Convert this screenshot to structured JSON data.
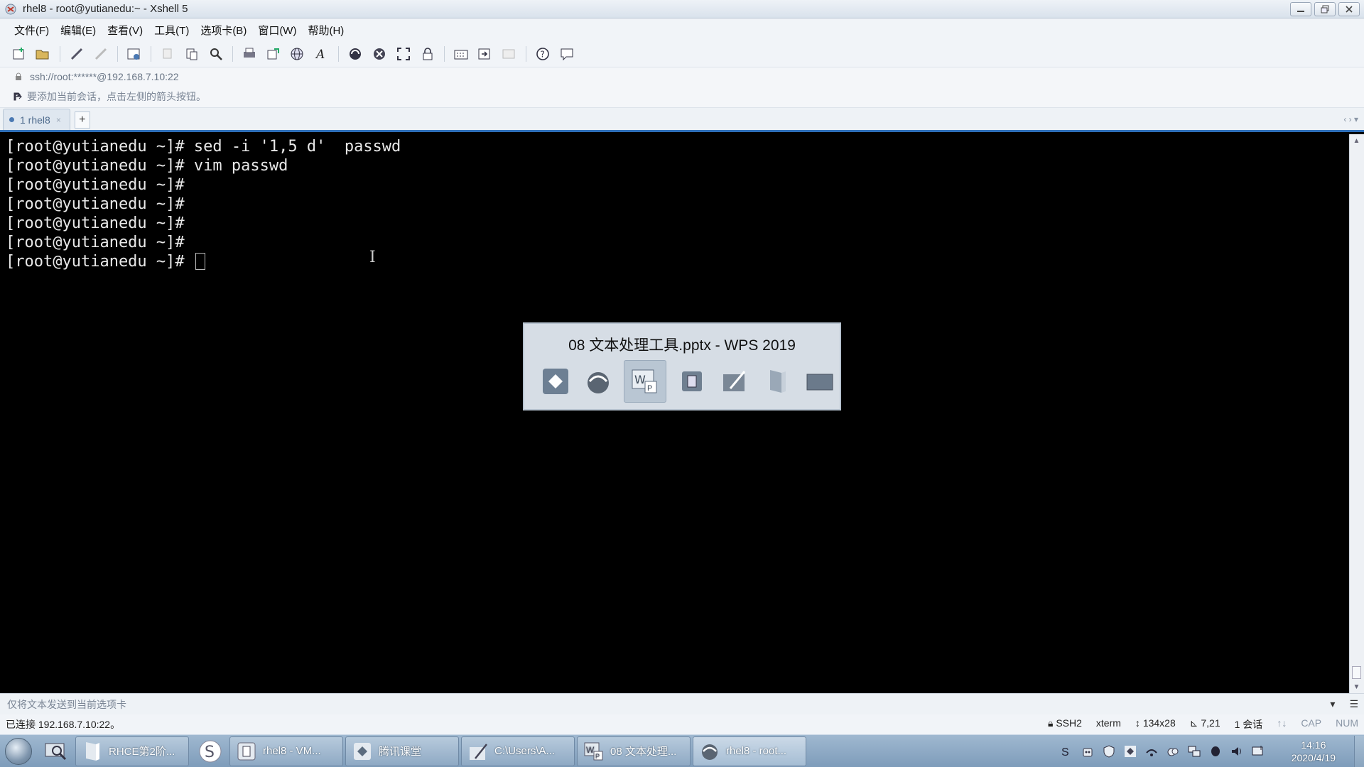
{
  "window": {
    "title": "rhel8 - root@yutianedu:~ - Xshell 5"
  },
  "menu": [
    "文件(F)",
    "编辑(E)",
    "查看(V)",
    "工具(T)",
    "选项卡(B)",
    "窗口(W)",
    "帮助(H)"
  ],
  "address": {
    "text": "ssh://root:******@192.168.7.10:22"
  },
  "infobar": {
    "text": "要添加当前会话，点击左侧的箭头按钮。"
  },
  "tabs": [
    {
      "label": "1 rhel8",
      "close": "×"
    }
  ],
  "tab_add": "+",
  "tab_nav": "‹ › ▾",
  "terminal": {
    "lines": [
      "[root@yutianedu ~]# sed -i '1,5 d'  passwd",
      "[root@yutianedu ~]# vim passwd",
      "[root@yutianedu ~]#",
      "[root@yutianedu ~]#",
      "[root@yutianedu ~]#",
      "[root@yutianedu ~]#",
      "[root@yutianedu ~]# "
    ]
  },
  "switcher": {
    "title": "08 文本处理工具.pptx - WPS 2019"
  },
  "sendbar": {
    "text": "仅将文本发送到当前选项卡"
  },
  "status": {
    "connected": "已连接 192.168.7.10:22。",
    "protocol": "SSH2",
    "term": "xterm",
    "size": "134x28",
    "cursor": "7,21",
    "sessions": "1 会话",
    "cap": "CAP",
    "num": "NUM"
  },
  "taskbar": {
    "items": [
      {
        "label": "RHCE第2阶..."
      },
      {
        "label": "rhel8 - VM..."
      },
      {
        "label": "腾讯课堂"
      },
      {
        "label": "C:\\Users\\A..."
      },
      {
        "label": "08 文本处理..."
      },
      {
        "label": "rhel8 - root..."
      }
    ],
    "clock_time": "14:16",
    "clock_date": "2020/4/19"
  },
  "colors": {
    "accent": "#2f6fb8",
    "terminal_bg": "#000000",
    "terminal_fg": "#e8e8e8"
  }
}
